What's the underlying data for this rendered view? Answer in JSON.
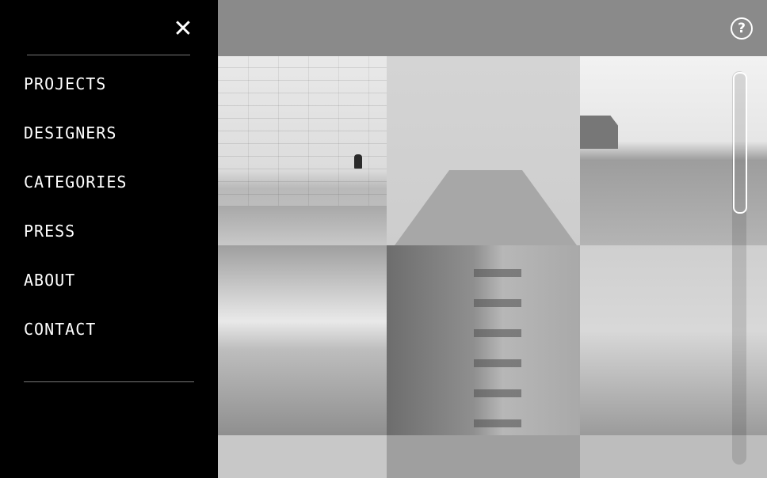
{
  "sidebar": {
    "close_icon": "close-icon",
    "nav": [
      "PROJECTS",
      "DESIGNERS",
      "CATEGORIES",
      "PRESS",
      "ABOUT",
      "CONTACT"
    ]
  },
  "topbar": {
    "help_label": "?"
  },
  "colors": {
    "sidebar_bg": "#000000",
    "text": "#ffffff",
    "overlay": "#8a8a8a"
  },
  "scroll": {
    "position_fraction": 0.0
  }
}
